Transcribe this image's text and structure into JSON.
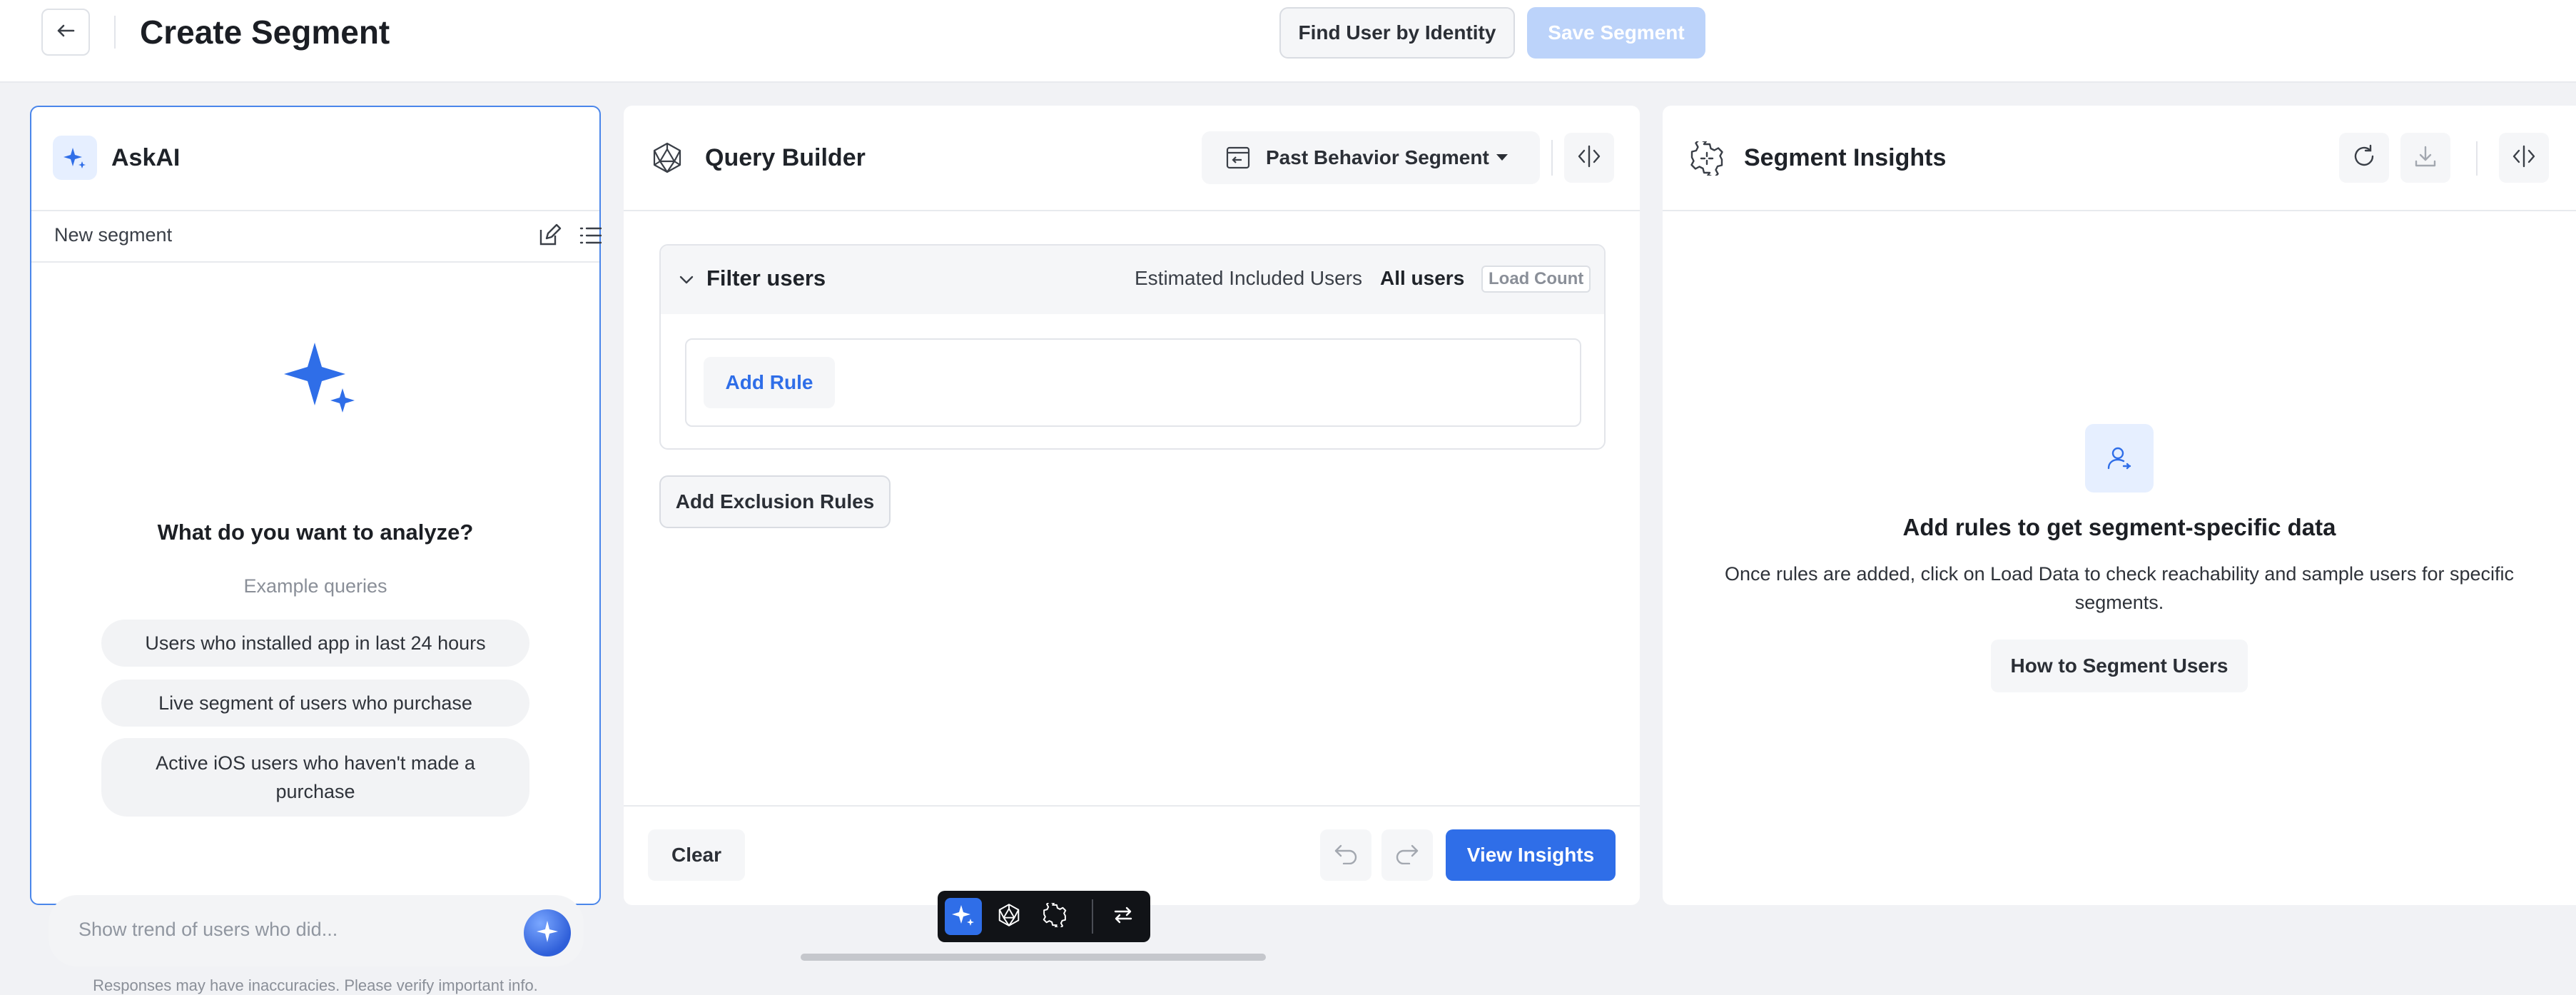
{
  "header": {
    "back_icon": "arrow-left-icon",
    "title": "Create Segment",
    "find_user_label": "Find User by Identity",
    "save_label": "Save Segment"
  },
  "askai": {
    "title": "AskAI",
    "logo_icon": "sparkle-icon",
    "session_label": "New segment",
    "edit_icon": "edit-icon",
    "history_icon": "list-icon",
    "headline": "What do you want to analyze?",
    "examples_label": "Example queries",
    "examples": [
      "Users who installed app in last 24 hours",
      "Live segment of users who purchase",
      "Active iOS users who haven't made a purchase"
    ],
    "input_placeholder": "Show trend of users who did...",
    "disclaimer": "Responses may have inaccuracies. Please verify important info."
  },
  "query_builder": {
    "title": "Query Builder",
    "segment_type": "Past Behavior Segment",
    "filter_title": "Filter users",
    "estimated_label": "Estimated Included Users",
    "estimated_value": "All users",
    "load_count_label": "Load Count",
    "add_rule_label": "Add Rule",
    "add_exclusion_label": "Add Exclusion Rules",
    "clear_label": "Clear",
    "view_insights_label": "View Insights"
  },
  "insights": {
    "title": "Segment Insights",
    "empty_title": "Add rules to get segment-specific data",
    "empty_desc": "Once rules are added, click on Load Data to check reachability and sample users for specific segments.",
    "how_label": "How to Segment Users"
  },
  "colors": {
    "accent": "#2f6ee8",
    "accent_light": "#e6efff",
    "save_disabled": "#bcd3fa",
    "askai_border": "#4a86ea"
  }
}
